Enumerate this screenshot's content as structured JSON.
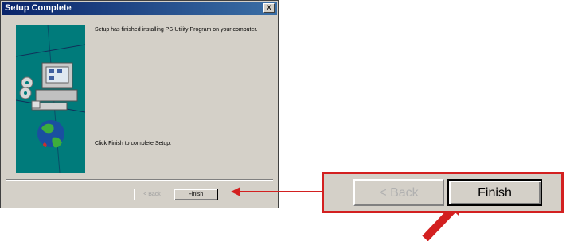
{
  "window": {
    "title": "Setup Complete",
    "close_label": "x"
  },
  "content": {
    "message": "Setup has finished installing PS-Utility Program on your computer.",
    "instruction": "Click Finish to complete Setup."
  },
  "buttons": {
    "back_label": "< Back",
    "finish_label": "Finish"
  },
  "callout": {
    "back_label": "< Back",
    "finish_label": "Finish"
  },
  "colors": {
    "accent": "#d32020",
    "titlebar": "#0a246a",
    "art_background": "#007b7b"
  }
}
